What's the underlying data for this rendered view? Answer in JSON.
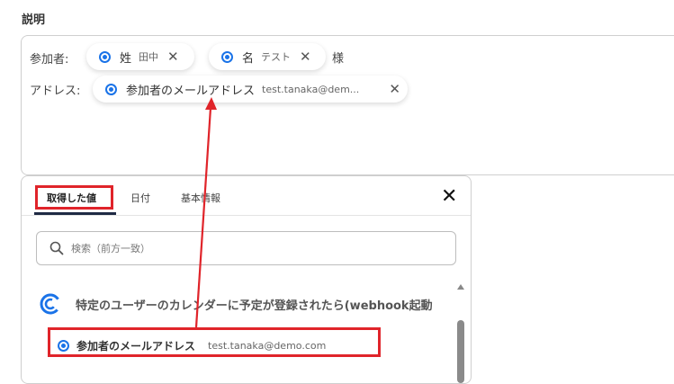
{
  "section_title": "説明",
  "description": {
    "participant_label": "参加者:",
    "participant_chips": [
      {
        "name": "姓",
        "value": "田中"
      },
      {
        "name": "名",
        "value": "テスト"
      }
    ],
    "suffix": "様",
    "address_label": "アドレス:",
    "address_chip": {
      "name": "参加者のメールアドレス",
      "value": "test.tanaka@dem..."
    }
  },
  "panel": {
    "tabs": [
      "取得した値",
      "日付",
      "基本情報"
    ],
    "active_tab": "取得した値",
    "search": {
      "placeholder": "検索（前方一致）"
    },
    "group_label": "特定のユーザーのカレンダーに予定が登録されたら(webhook起動",
    "item": {
      "name": "参加者のメールアドレス",
      "value": "test.tanaka@demo.com"
    }
  },
  "colors": {
    "accent": "#1a73e8",
    "highlight": "#e0242a"
  },
  "icons": [
    "close-icon",
    "search-icon",
    "radio-dot-icon",
    "trigger-app-icon",
    "arrow-annotation"
  ]
}
